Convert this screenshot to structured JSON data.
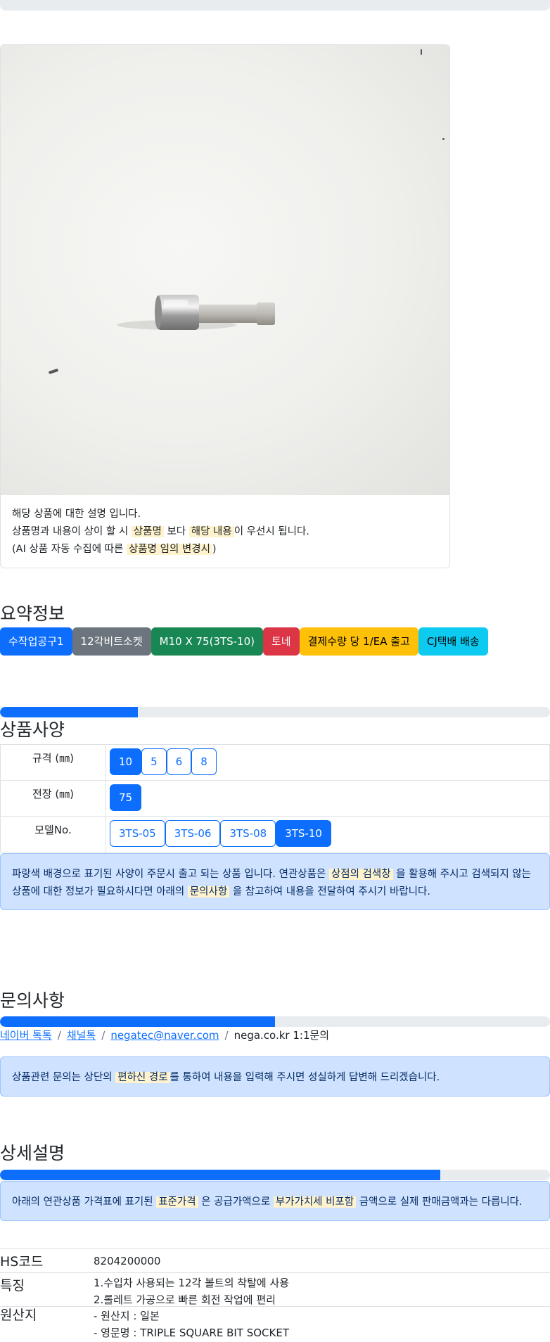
{
  "product_image": {
    "alt": "12각 비트소켓 M10 X 75"
  },
  "notice": {
    "line1": "해당 상품에 대한 설명 입니다.",
    "line2_pre": "상품명과 내용이 상이 할 시",
    "line2_mark1": "상품명",
    "line2_mid": "보다",
    "line2_mark2": "해당 내용",
    "line2_post": "이 우선시 됩니다.",
    "line3_pre": "(AI 상품 자동 수집에 따른",
    "line3_mark": "상품명 임의 변경시",
    "line3_post": ")"
  },
  "summary": {
    "title": "요약정보",
    "badges": [
      {
        "label": "수작업공구1",
        "bg": "#0d6efd",
        "fg": "#ffffff"
      },
      {
        "label": "12각비트소켓",
        "bg": "#6c757d",
        "fg": "#ffffff"
      },
      {
        "label": "M10 X 75(3TS-10)",
        "bg": "#198754",
        "fg": "#ffffff"
      },
      {
        "label": "토네",
        "bg": "#dc3545",
        "fg": "#ffffff"
      },
      {
        "label": "결제수량 당 1/EA 출고",
        "bg": "#ffc107",
        "fg": "#000000"
      },
      {
        "label": "CJ택배 배송",
        "bg": "#0dcaf0",
        "fg": "#000000"
      }
    ]
  },
  "spec": {
    "title": "상품사양",
    "progress": 0.25,
    "rows": [
      {
        "label": "규격 (㎜)",
        "options": [
          "10",
          "5",
          "6",
          "8"
        ],
        "selected": "10"
      },
      {
        "label": "전장 (㎜)",
        "options": [
          "75"
        ],
        "selected": "75"
      },
      {
        "label": "모델No.",
        "options": [
          "3TS-05",
          "3TS-06",
          "3TS-08",
          "3TS-10"
        ],
        "selected": "3TS-10"
      }
    ],
    "alert": {
      "pre": "파랑색 배경으로 표기된 사양이 주문시 출고 되는 상품 입니다. 연관상품은",
      "mark1": "상점의 검색창",
      "mid": "을 활용해 주시고 검색되지 않는 상품에 대한 정보가 필요하시다면 아래의",
      "mark2": "문의사항",
      "post": "을 참고하여 내용을 전달하여 주시기 바랍니다."
    }
  },
  "inquiry": {
    "title": "문의사항",
    "progress": 0.5,
    "links": [
      "네이버 톡톡",
      "채널톡",
      "negatec@naver.com"
    ],
    "plain": "nega.co.kr 1:1문의",
    "alert": {
      "pre": "상품관련 문의는 상단의",
      "mark": "편하신 경로",
      "post": "를 통하여 내용을 입력해 주시면 성실하게 답변해 드리겠습니다."
    }
  },
  "detail": {
    "title": "상세설명",
    "progress": 0.8,
    "alert": {
      "pre": "아래의 연관상품 가격표에 표기된",
      "mark1": "표준가격",
      "mid": "은 공급가액으로",
      "mark2": "부가가치세 비포함",
      "post": "금액으로 실제 판매금액과는 다릅니다."
    },
    "info": [
      {
        "key": "HS코드",
        "lines": [
          "8204200000"
        ]
      },
      {
        "key": "특징",
        "lines": [
          "1.수입차 사용되는 12각 볼트의 착탈에 사용",
          "2.롤레트 가공으로 빠른 회전 작업에 편리"
        ]
      },
      {
        "key": "원산지",
        "lines": [
          "- 원산지 : 일본",
          "- 영문명 : TRIPLE SQUARE BIT SOCKET"
        ]
      }
    ]
  }
}
